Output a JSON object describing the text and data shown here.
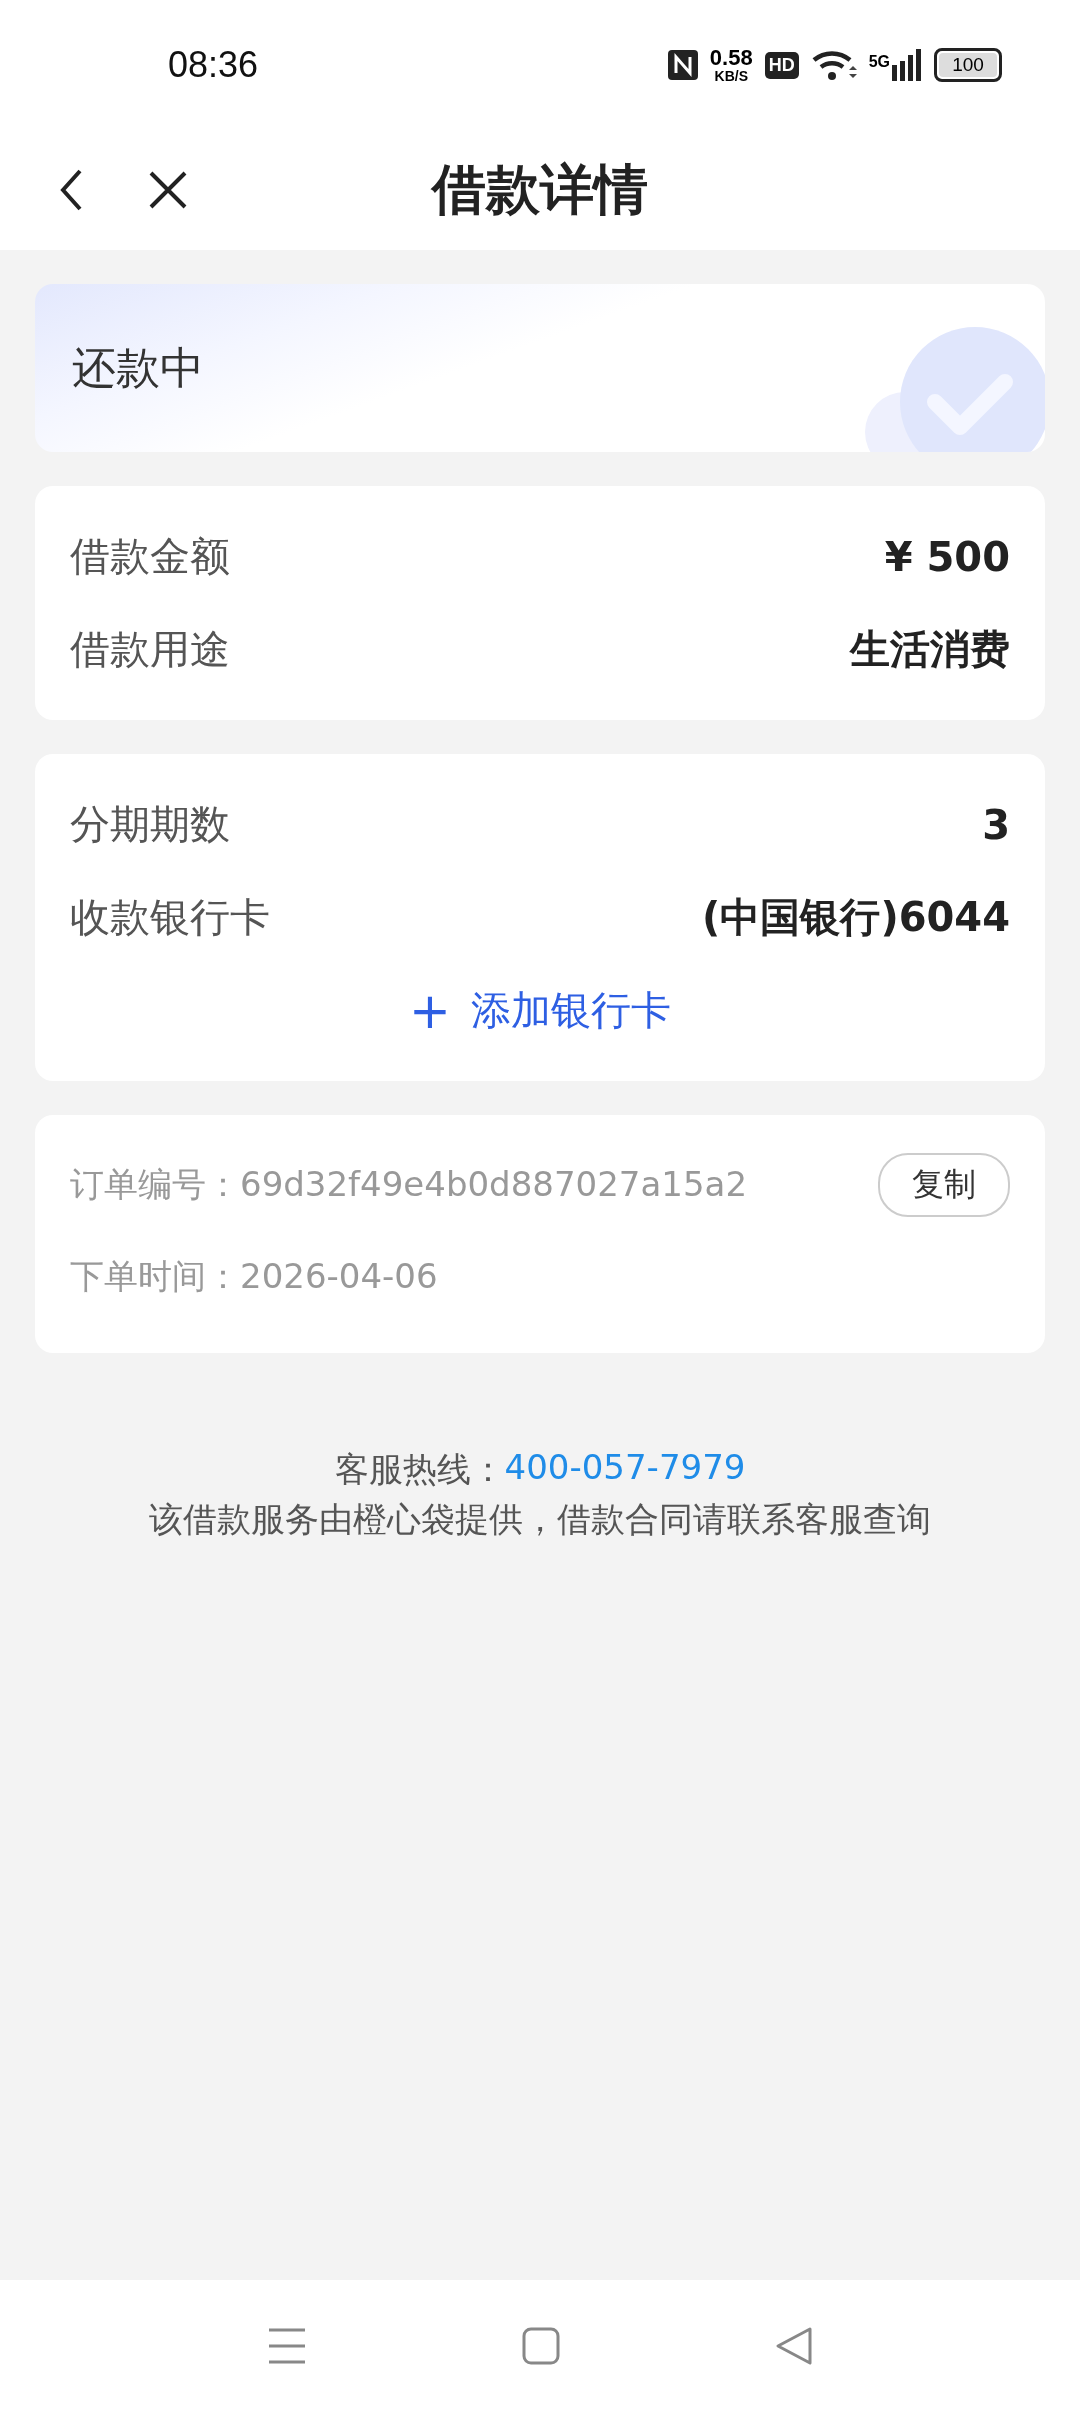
{
  "status_bar": {
    "time": "08:36",
    "net_speed": "0.58",
    "net_unit": "KB/S",
    "hd": "HD",
    "network": "5G",
    "battery": "100"
  },
  "header": {
    "title": "借款详情"
  },
  "status_card": {
    "label": "还款中"
  },
  "loan_card": {
    "rows": [
      {
        "label": "借款金额",
        "value": "¥ 500"
      },
      {
        "label": "借款用途",
        "value": "生活消费"
      }
    ]
  },
  "installment_card": {
    "rows": [
      {
        "label": "分期期数",
        "value": "3"
      },
      {
        "label": "收款银行卡",
        "value": "(中国银行)6044"
      }
    ],
    "add_card": {
      "icon": "+",
      "label": "添加银行卡"
    }
  },
  "order_card": {
    "order_label": "订单编号：",
    "order_number": "69d32f49e4b0d887027a15a2",
    "copy_button": "复制",
    "time_label": "下单时间：",
    "time_value": "2026-04-06"
  },
  "footer": {
    "hotline_label": "客服热线：",
    "hotline_number": "400-057-7979",
    "note": "该借款服务由橙心袋提供，借款合同请联系客服查询"
  }
}
